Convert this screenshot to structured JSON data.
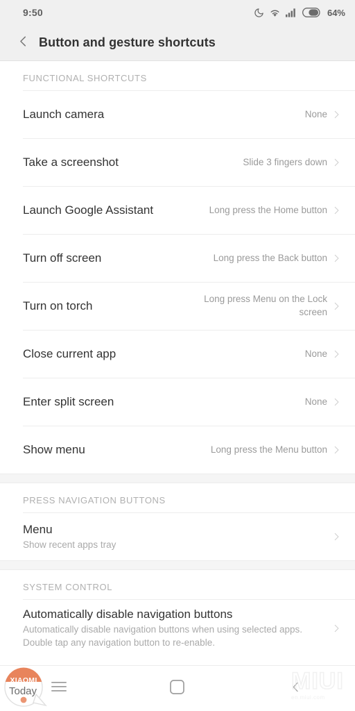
{
  "status_bar": {
    "time": "9:50",
    "battery_percent": "64%",
    "icons": [
      "dnd-moon-icon",
      "wifi-icon",
      "signal-bars-icon",
      "battery-icon"
    ]
  },
  "header": {
    "back_icon": "chevron-left-icon",
    "title": "Button and gesture shortcuts"
  },
  "sections": [
    {
      "header": "FUNCTIONAL SHORTCUTS",
      "rows": [
        {
          "title": "Launch camera",
          "value": "None"
        },
        {
          "title": "Take a screenshot",
          "value": "Slide 3 fingers down"
        },
        {
          "title": "Launch Google Assistant",
          "value": "Long press the Home button"
        },
        {
          "title": "Turn off screen",
          "value": "Long press the Back button"
        },
        {
          "title": "Turn on torch",
          "value": "Long press Menu on the Lock screen"
        },
        {
          "title": "Close current app",
          "value": "None"
        },
        {
          "title": "Enter split screen",
          "value": "None"
        },
        {
          "title": "Show menu",
          "value": "Long press the Menu button"
        }
      ]
    },
    {
      "header": "PRESS NAVIGATION BUTTONS",
      "rows": [
        {
          "title": "Menu",
          "subtitle": "Show recent apps tray"
        }
      ]
    },
    {
      "header": "SYSTEM CONTROL",
      "rows": [
        {
          "title": "Automatically disable navigation buttons",
          "subtitle": "Automatically disable navigation buttons when using selected apps. Double tap any navigation button to re-enable."
        }
      ]
    }
  ],
  "nav_bar": {
    "buttons": [
      "menu-icon",
      "home-icon",
      "back-icon"
    ]
  },
  "watermarks": {
    "xiaomi_top": "XIAOMI",
    "xiaomi_bottom": "Today",
    "miui": "MIUI",
    "miui_sub": "en.miui.com"
  },
  "colors": {
    "status_bg": "#f0f0f0",
    "title_text": "#333333",
    "value_text": "#9a9a9a",
    "section_header": "#b0b0b0",
    "divider": "#ededed",
    "xiaomi_orange": "#e8845c"
  }
}
